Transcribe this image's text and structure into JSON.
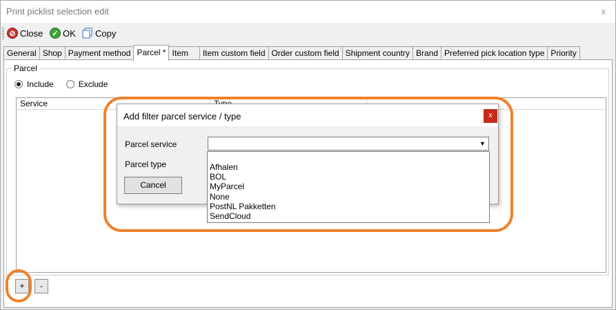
{
  "window": {
    "title": "Print picklist selection edit",
    "close_label": "x"
  },
  "toolbar": {
    "close_label": "Close",
    "ok_label": "OK",
    "copy_label": "Copy"
  },
  "tabs": [
    {
      "label": "General"
    },
    {
      "label": "Shop"
    },
    {
      "label": "Payment method"
    },
    {
      "label": "Parcel *"
    },
    {
      "label": "Item"
    },
    {
      "label": "Item custom field"
    },
    {
      "label": "Order custom field"
    },
    {
      "label": "Shipment country"
    },
    {
      "label": "Brand"
    },
    {
      "label": "Preferred pick location type"
    },
    {
      "label": "Priority"
    }
  ],
  "parcel_group": {
    "legend": "Parcel",
    "include_label": "Include",
    "exclude_label": "Exclude",
    "selected": "Include",
    "columns": [
      "Service",
      "Type"
    ]
  },
  "bottom_buttons": {
    "add_label": "+",
    "remove_label": "-"
  },
  "dialog": {
    "title": "Add filter parcel service / type",
    "close_label": "x",
    "parcel_service_label": "Parcel service",
    "parcel_type_label": "Parcel type",
    "parcel_service_value": "",
    "cancel_label": "Cancel",
    "dropdown_options": [
      "",
      "Afhalen",
      "BOL",
      "MyParcel",
      "None",
      "PostNL Pakketten",
      "SendCloud"
    ]
  },
  "colors": {
    "highlight": "#f0802a",
    "dialog_close": "#c42b1c"
  }
}
